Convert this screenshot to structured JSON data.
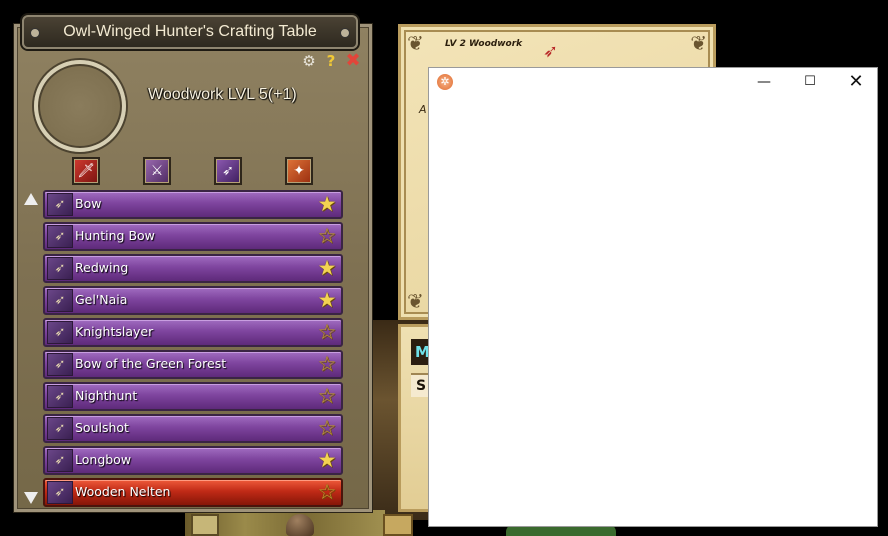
{
  "crafting": {
    "title": "Owl-Winged Hunter's Crafting Table",
    "level_text": "Woodwork LVL 5(+1)",
    "categories": [
      {
        "icon": "sword-icon",
        "color": "#c0281e"
      },
      {
        "icon": "dagger-icon",
        "color": "#7e4a96"
      },
      {
        "icon": "bow-icon",
        "color": "#6e3c96"
      },
      {
        "icon": "staff-icon",
        "color": "#c8501e"
      }
    ],
    "recipes": [
      {
        "label": "Bow",
        "icon": "bow-icon",
        "starred": true
      },
      {
        "label": "Hunting Bow",
        "icon": "bow-icon",
        "starred": false
      },
      {
        "label": "Redwing",
        "icon": "bow-icon",
        "starred": true
      },
      {
        "label": "Gel'Naia",
        "icon": "bow-icon",
        "starred": true
      },
      {
        "label": "Knightslayer",
        "icon": "bow-icon",
        "starred": false
      },
      {
        "label": "Bow of the Green Forest",
        "icon": "bow-icon",
        "starred": false
      },
      {
        "label": "Nighthunt",
        "icon": "bow-icon",
        "starred": false
      },
      {
        "label": "Soulshot",
        "icon": "bow-icon",
        "starred": false
      },
      {
        "label": "Longbow",
        "icon": "bow-icon",
        "starred": true
      },
      {
        "label": "Wooden Nelten",
        "icon": "bow-icon",
        "starred": false,
        "selected": true
      }
    ]
  },
  "parchment": {
    "header": "LV 2 Woodwork",
    "fragment_a": "A",
    "tab_m": "M",
    "tab_s": "S"
  },
  "window": {
    "minimize": "—",
    "maximize": "☐",
    "close": "✕"
  },
  "colors": {
    "recipe_bg": "#7e449e",
    "recipe_selected_bg": "#c02a16",
    "star": "#f3d352",
    "panel_bg": "#7f7152"
  }
}
